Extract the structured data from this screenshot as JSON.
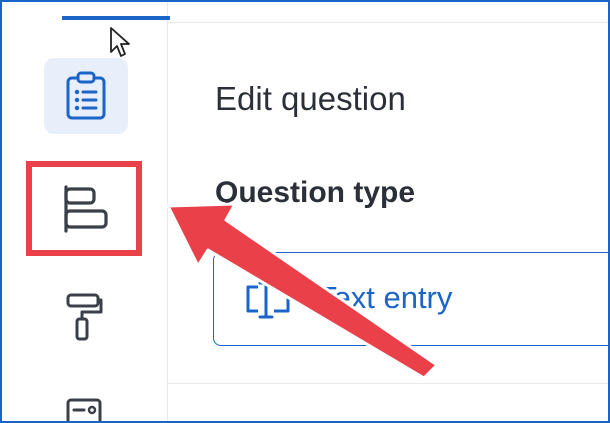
{
  "main": {
    "title": "Edit question",
    "question_type_label": "Question type",
    "question_type_value": "Text entry"
  },
  "sidebar": {
    "items": [
      {
        "icon": "clipboard-list-icon",
        "active": true
      },
      {
        "icon": "layout-blocks-icon",
        "active": false,
        "highlighted": true
      },
      {
        "icon": "paint-roller-icon",
        "active": false
      },
      {
        "icon": "id-card-icon",
        "active": false
      }
    ]
  },
  "colors": {
    "accent": "#1b65c9",
    "highlight": "#e9404a",
    "active_bg": "#e8effa",
    "text": "#2b2f37",
    "icon": "#3a3f48"
  }
}
